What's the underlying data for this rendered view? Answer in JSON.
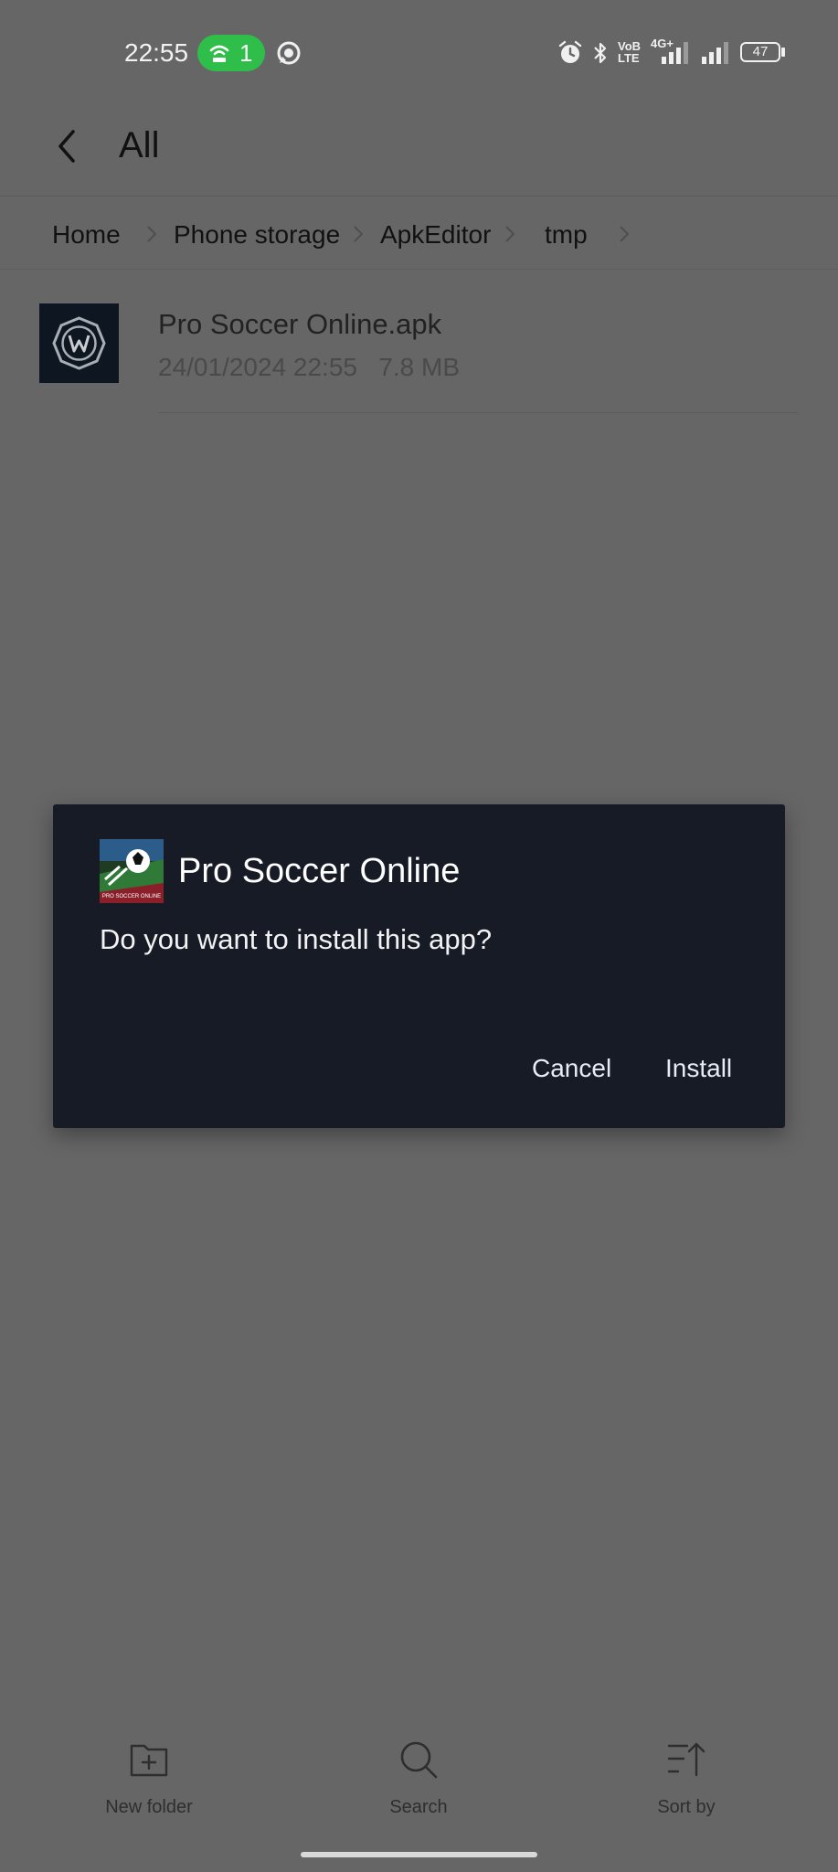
{
  "status_bar": {
    "time": "22:55",
    "hotspot_count": "1",
    "network_label": "4G+",
    "volte_top": "VoB",
    "volte_bottom": "LTE",
    "battery_level": "47"
  },
  "header": {
    "title": "All"
  },
  "breadcrumb": {
    "items": [
      "Home",
      "Phone storage",
      "ApkEditor",
      "tmp"
    ]
  },
  "file_list": [
    {
      "name": "Pro Soccer Online.apk",
      "date": "24/01/2024 22:55",
      "size": "7.8 MB"
    }
  ],
  "dialog": {
    "app_name": "Pro Soccer Online",
    "message": "Do you want to install this app?",
    "cancel_label": "Cancel",
    "install_label": "Install",
    "app_icon_text": "PRO SOCCER ONLINE"
  },
  "toolbar": {
    "new_folder_label": "New folder",
    "search_label": "Search",
    "sort_label": "Sort by"
  },
  "colors": {
    "scrim_background": "#666666",
    "dialog_background": "#171b26",
    "hotspot_green": "#2fbe4a"
  },
  "icons": [
    "whatsapp-icon",
    "alarm-icon",
    "bluetooth-icon",
    "signal-icon",
    "battery-icon",
    "back-icon",
    "chevron-right-icon",
    "new-folder-icon",
    "search-icon",
    "sort-icon"
  ]
}
